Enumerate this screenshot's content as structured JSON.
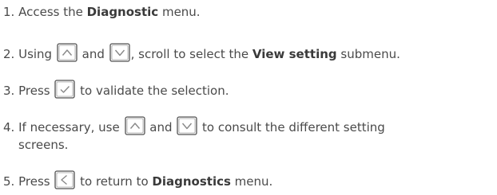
{
  "steps": [
    {
      "number": "1.",
      "text_a": "Access the ",
      "bold": "Diagnostic",
      "text_b": " menu."
    },
    {
      "number": "2.",
      "text_a": "Using ",
      "icon1": "up-arrow-key-icon",
      "text_b": " and ",
      "icon2": "down-arrow-key-icon",
      "text_c": ", scroll to select the ",
      "bold": "View setting",
      "text_d": " submenu."
    },
    {
      "number": "3.",
      "text_a": "Press ",
      "icon1": "check-key-icon",
      "text_b": " to validate the selection."
    },
    {
      "number": "4.",
      "text_a": "If necessary, use ",
      "icon1": "up-arrow-key-icon",
      "text_b": " and ",
      "icon2": "down-arrow-key-icon",
      "text_c": " to consult the different setting",
      "text_d": "screens."
    },
    {
      "number": "5.",
      "text_a": "Press ",
      "icon1": "back-arrow-key-icon",
      "text_b": " to return to ",
      "bold": "Diagnostics",
      "text_c": " menu."
    }
  ],
  "colors": {
    "text": "#4a4a4a",
    "key_border": "#555555",
    "key_fill": "#f2f2f2",
    "glyph": "#888888"
  }
}
